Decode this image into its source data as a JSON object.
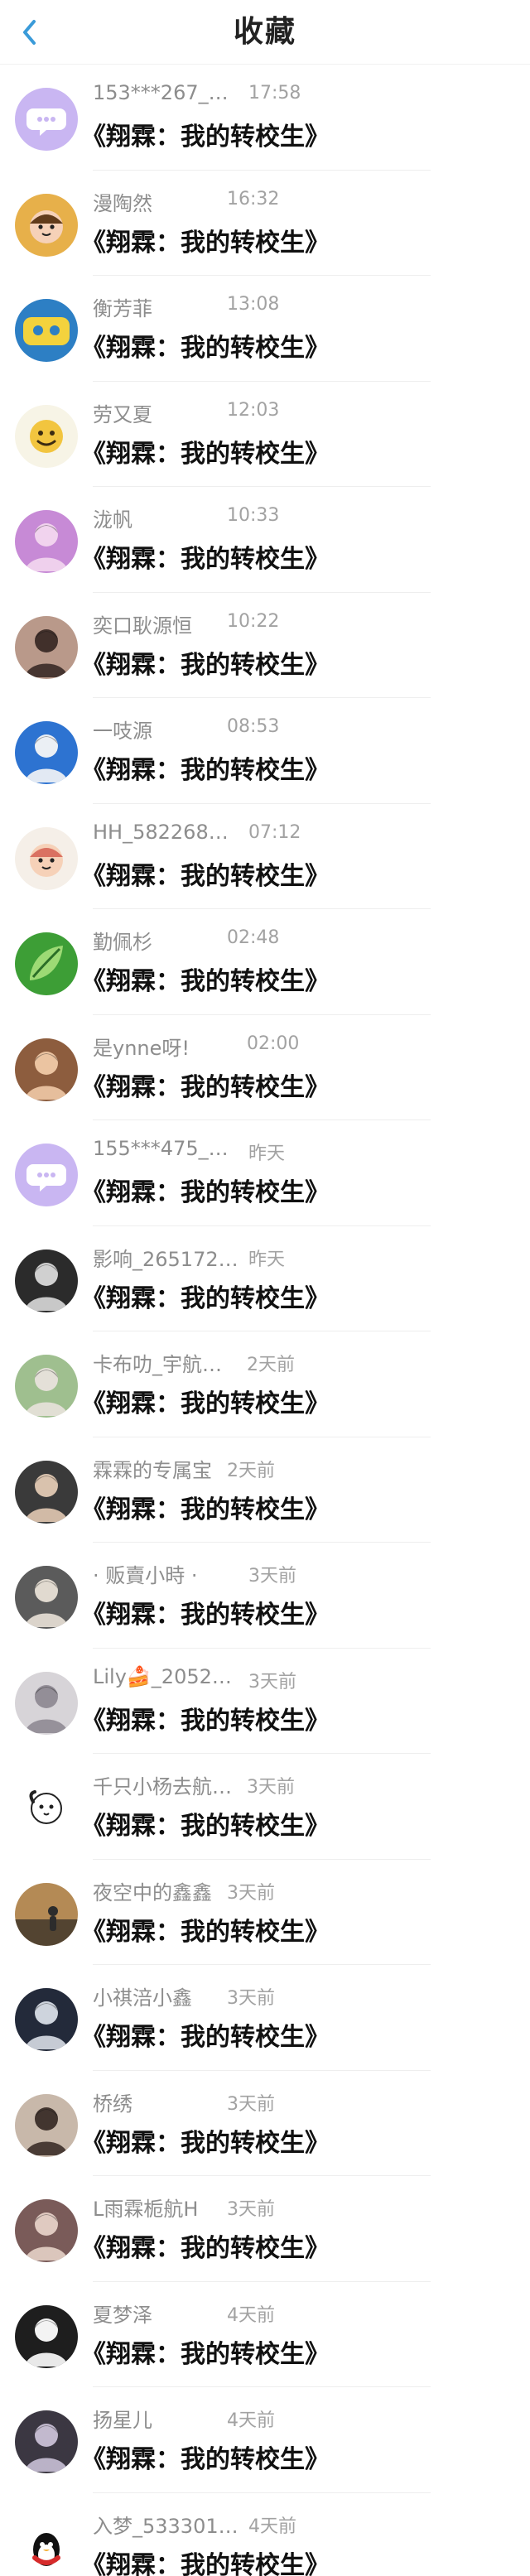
{
  "header": {
    "title": "收藏",
    "back_icon": "chevron-left-icon",
    "accent": "#3a9bd9"
  },
  "items": [
    {
      "name": "153***267_…",
      "time": "17:58",
      "content": "《翔霖：我的转校生》",
      "avatar": {
        "bg": "#c9b6f2",
        "fg": "#ffffff",
        "icon": "chat-bubble-icon"
      }
    },
    {
      "name": "漫陶然",
      "time": "16:32",
      "content": "《翔霖：我的转校生》",
      "avatar": {
        "bg": "#e7b04a",
        "fg": "#5a3412",
        "icon": "cartoon-face-icon"
      }
    },
    {
      "name": "衡芳菲",
      "time": "13:08",
      "content": "《翔霖：我的转校生》",
      "avatar": {
        "bg": "#2d7fc4",
        "fg": "#f3d23d",
        "icon": "sticker-icon"
      }
    },
    {
      "name": "劳又夏",
      "time": "12:03",
      "content": "《翔霖：我的转校生》",
      "avatar": {
        "bg": "#f7f4e6",
        "fg": "#f2c53f",
        "icon": "emoji-icon"
      }
    },
    {
      "name": "泷帆",
      "time": "10:33",
      "content": "《翔霖：我的转校生》",
      "avatar": {
        "bg": "#c78ad6",
        "fg": "#f3d7ef",
        "icon": "person-photo-icon"
      }
    },
    {
      "name": "奕口耿源恒",
      "time": "10:22",
      "content": "《翔霖：我的转校生》",
      "avatar": {
        "bg": "#b9998a",
        "fg": "#3a2a26",
        "icon": "person-photo-icon"
      }
    },
    {
      "name": "一吱源",
      "time": "08:53",
      "content": "《翔霖：我的转校生》",
      "avatar": {
        "bg": "#2d73d1",
        "fg": "#f6f6f6",
        "icon": "person-photo-icon"
      }
    },
    {
      "name": "HH_582268…",
      "time": "07:12",
      "content": "《翔霖：我的转校生》",
      "avatar": {
        "bg": "#f5efe8",
        "fg": "#d86b5c",
        "icon": "cartoon-face-icon"
      }
    },
    {
      "name": "勤佩杉",
      "time": "02:48",
      "content": "《翔霖：我的转校生》",
      "avatar": {
        "bg": "#3d9e36",
        "fg": "#a7e07c",
        "icon": "leaf-icon"
      }
    },
    {
      "name": "是ynne呀!",
      "time": "02:00",
      "content": "《翔霖：我的转校生》",
      "avatar": {
        "bg": "#8d5d3e",
        "fg": "#f0c9a6",
        "icon": "person-photo-icon"
      }
    },
    {
      "name": "155***475_…",
      "time": "昨天",
      "content": "《翔霖：我的转校生》",
      "avatar": {
        "bg": "#c9b6f2",
        "fg": "#ffffff",
        "icon": "chat-bubble-icon"
      }
    },
    {
      "name": "影响_265172…",
      "time": "昨天",
      "content": "《翔霖：我的转校生》",
      "avatar": {
        "bg": "#2b2b2b",
        "fg": "#d9d9d9",
        "icon": "person-photo-icon"
      }
    },
    {
      "name": "卡布叻_宇航…",
      "time": "2天前",
      "content": "《翔霖：我的转校生》",
      "avatar": {
        "bg": "#9fbf8f",
        "fg": "#e8e2dc",
        "icon": "person-photo-icon"
      }
    },
    {
      "name": "霖霖的专属宝",
      "time": "2天前",
      "content": "《翔霖：我的转校生》",
      "avatar": {
        "bg": "#3a3a3a",
        "fg": "#e2c9b3",
        "icon": "person-photo-icon"
      }
    },
    {
      "name": "· 贩賣小時 ·",
      "time": "3天前",
      "content": "《翔霖：我的转校生》",
      "avatar": {
        "bg": "#5b5b5b",
        "fg": "#e9e1d7",
        "icon": "person-photo-icon"
      }
    },
    {
      "name": "Lily🍰_2052…",
      "time": "3天前",
      "content": "《翔霖：我的转校生》",
      "avatar": {
        "bg": "#d7d4d8",
        "fg": "#8f8a93",
        "icon": "person-photo-icon"
      }
    },
    {
      "name": "千只小杨去航…",
      "time": "3天前",
      "content": "《翔霖：我的转校生》",
      "avatar": {
        "bg": "#ffffff",
        "fg": "#222222",
        "icon": "cartoon-dog-icon"
      }
    },
    {
      "name": "夜空中的鑫鑫",
      "time": "3天前",
      "content": "《翔霖：我的转校生》",
      "avatar": {
        "bg": "#b48a55",
        "fg": "#2c2c2c",
        "icon": "silhouette-icon"
      }
    },
    {
      "name": "小祺涪小鑫",
      "time": "3天前",
      "content": "《翔霖：我的转校生》",
      "avatar": {
        "bg": "#232a3a",
        "fg": "#d8dde6",
        "icon": "person-photo-icon"
      }
    },
    {
      "name": "桥绣",
      "time": "3天前",
      "content": "《翔霖：我的转校生》",
      "avatar": {
        "bg": "#c8b8aa",
        "fg": "#3b2d28",
        "icon": "person-photo-icon"
      }
    },
    {
      "name": "L雨霖栀航H",
      "time": "3天前",
      "content": "《翔霖：我的转校生》",
      "avatar": {
        "bg": "#7a5b59",
        "fg": "#e6d1c7",
        "icon": "person-photo-icon"
      }
    },
    {
      "name": "夏梦泽",
      "time": "4天前",
      "content": "《翔霖：我的转校生》",
      "avatar": {
        "bg": "#1e1e1e",
        "fg": "#ffffff",
        "icon": "person-photo-icon"
      }
    },
    {
      "name": "扬星儿",
      "time": "4天前",
      "content": "《翔霖：我的转校生》",
      "avatar": {
        "bg": "#3b3742",
        "fg": "#c9c0d6",
        "icon": "person-photo-icon"
      }
    },
    {
      "name": "入梦_533301…",
      "time": "4天前",
      "content": "《翔霖：我的转校生》",
      "avatar": {
        "bg": "#ffffff",
        "fg": "#111111",
        "icon": "penguin-icon"
      }
    }
  ]
}
